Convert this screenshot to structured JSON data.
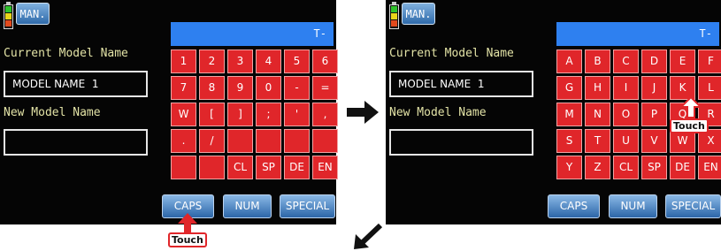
{
  "left_screen": {
    "battery_icon": "battery-icon",
    "man_button": "MAN.",
    "current_label": "Current Model Name",
    "current_value": "MODEL NAME  1",
    "new_label": "New Model Name",
    "new_value": "",
    "display_text": "T-",
    "keys": [
      "1",
      "2",
      "3",
      "4",
      "5",
      "6",
      "7",
      "8",
      "9",
      "0",
      "-",
      "=",
      "W",
      "[",
      "]",
      ";",
      "'",
      ",",
      ".",
      "/",
      "",
      "",
      "",
      "",
      "",
      "",
      "CL",
      "SP",
      "DE",
      "EN"
    ],
    "mode_buttons": {
      "caps": "CAPS",
      "num": "NUM",
      "special": "SPECIAL"
    },
    "touch_label": "Touch"
  },
  "right_screen": {
    "man_button": "MAN.",
    "current_label": "Current Model Name",
    "current_value": "MODEL NAME  1",
    "new_label": "New Model Name",
    "new_value": "",
    "display_text": "T-",
    "keys": [
      "A",
      "B",
      "C",
      "D",
      "E",
      "F",
      "G",
      "H",
      "I",
      "J",
      "K",
      "L",
      "M",
      "N",
      "O",
      "P",
      "Q",
      "R",
      "S",
      "T",
      "U",
      "V",
      "W",
      "X",
      "Y",
      "Z",
      "CL",
      "SP",
      "DE",
      "EN"
    ],
    "mode_buttons": {
      "caps": "CAPS",
      "num": "NUM",
      "special": "SPECIAL"
    },
    "touch_label": "Touch"
  },
  "colors": {
    "key_red": "#e0262a",
    "display_blue": "#2e80f0",
    "label_yellow": "#e3e3a6",
    "button_blue": "#2c66a8"
  },
  "icons": [
    "battery-icon",
    "arrow-right-icon",
    "arrow-down-left-icon",
    "touch-arrow-icon"
  ]
}
